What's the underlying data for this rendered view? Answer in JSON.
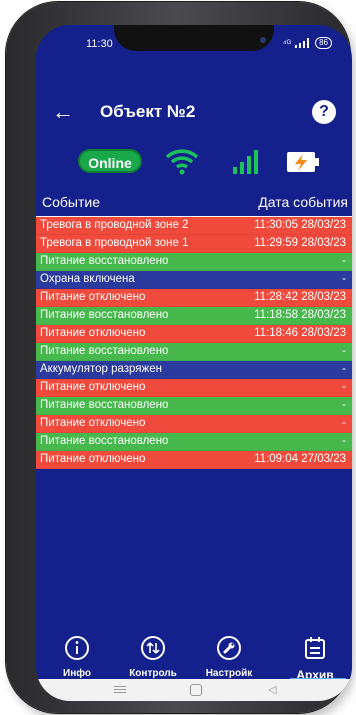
{
  "statusbar": {
    "time": "11:30",
    "signal_text": "⁴ᴳ",
    "battery_text": "86"
  },
  "header": {
    "title": "Объект №2",
    "help_label": "?"
  },
  "status": {
    "online_label": "Online"
  },
  "table": {
    "col_event": "Событие",
    "col_date": "Дата события",
    "rows": [
      {
        "event": "Тревога в проводной зоне 2",
        "date": "11:30:05 28/03/23",
        "color": "red"
      },
      {
        "event": "Тревога в проводной зоне 1",
        "date": "11:29:59 28/03/23",
        "color": "red"
      },
      {
        "event": "Питание восстановлено",
        "date": "-",
        "color": "green"
      },
      {
        "event": "Охрана включена",
        "date": "-",
        "color": "blue"
      },
      {
        "event": "Питание отключено",
        "date": "11:28:42 28/03/23",
        "color": "red"
      },
      {
        "event": "Питание восстановлено",
        "date": "11:18:58 28/03/23",
        "color": "green"
      },
      {
        "event": "Питание отключено",
        "date": "11:18:46 28/03/23",
        "color": "red"
      },
      {
        "event": "Питание восстановлено",
        "date": "-",
        "color": "green"
      },
      {
        "event": "Аккумулятор разряжен",
        "date": "-",
        "color": "blue"
      },
      {
        "event": "Питание отключено",
        "date": "-",
        "color": "red"
      },
      {
        "event": "Питание восстановлено",
        "date": "-",
        "color": "green"
      },
      {
        "event": "Питание отключено",
        "date": "-",
        "color": "red"
      },
      {
        "event": "Питание восстановлено",
        "date": "-",
        "color": "green"
      },
      {
        "event": "Питание отключено",
        "date": "11:09:04 27/03/23",
        "color": "red"
      }
    ]
  },
  "nav": {
    "info": "Инфо",
    "control": "Контроль",
    "settings": "Настройк",
    "archive": "Архив"
  },
  "colors": {
    "background": "#14208c",
    "red": "#f04a3c",
    "green": "#46b84c",
    "blue": "#2a3a9e",
    "accent": "#5aa7ff"
  }
}
